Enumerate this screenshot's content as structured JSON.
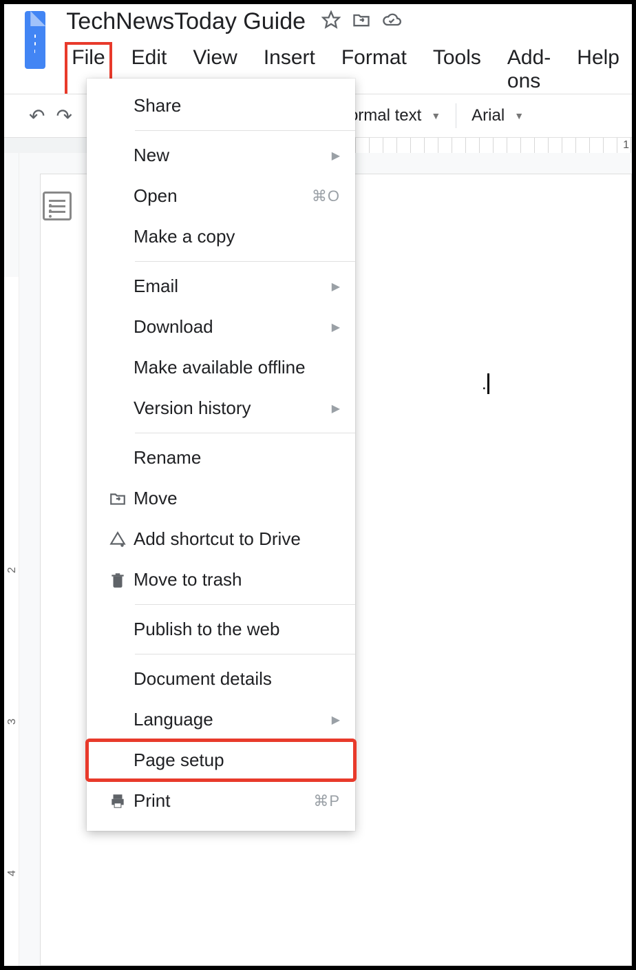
{
  "doc_title": "TechNewsToday Guide",
  "menubar": {
    "file": "File",
    "edit": "Edit",
    "view": "View",
    "insert": "Insert",
    "format": "Format",
    "tools": "Tools",
    "addons": "Add-ons",
    "help": "Help"
  },
  "toolbar": {
    "style_label": "ormal text",
    "font_label": "Arial"
  },
  "ruler": {
    "num": "1"
  },
  "vruler": {
    "n2": "2",
    "n3": "3",
    "n4": "4"
  },
  "file_menu": {
    "share": "Share",
    "new": "New",
    "open": "Open",
    "open_shortcut": "⌘O",
    "make_copy": "Make a copy",
    "email": "Email",
    "download": "Download",
    "offline": "Make available offline",
    "version": "Version history",
    "rename": "Rename",
    "move": "Move",
    "shortcut": "Add shortcut to Drive",
    "trash": "Move to trash",
    "publish": "Publish to the web",
    "details": "Document details",
    "language": "Language",
    "page_setup": "Page setup",
    "print": "Print",
    "print_shortcut": "⌘P"
  }
}
